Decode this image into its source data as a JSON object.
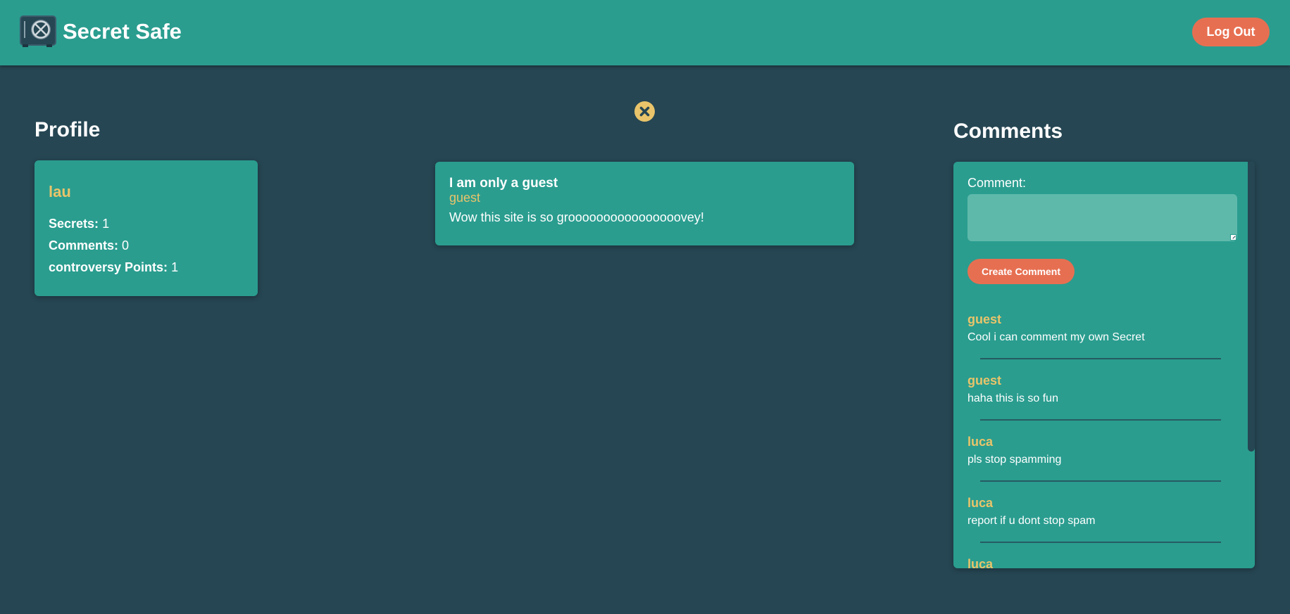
{
  "header": {
    "app_title": "Secret Safe",
    "logout_label": "Log Out",
    "logo_icon": "safe-icon"
  },
  "colors": {
    "background": "#264653",
    "primary": "#2a9d8f",
    "accent": "#e9c46a",
    "button": "#e76f51"
  },
  "profile": {
    "section_title": "Profile",
    "username": "lau",
    "stats": {
      "secrets_label": "Secrets:",
      "secrets_value": "1",
      "comments_label": "Comments:",
      "comments_value": "0",
      "points_label": "controversy Points:",
      "points_value": "1"
    }
  },
  "secret": {
    "close_icon": "close-icon",
    "title": "I am only a guest",
    "author": "guest",
    "body": "Wow this site is so groooooooooooooooovey!"
  },
  "comments": {
    "section_title": "Comments",
    "input_label": "Comment:",
    "input_value": "",
    "input_placeholder": "",
    "create_label": "Create Comment",
    "items": [
      {
        "author": "guest",
        "text": "Cool i can comment my own Secret"
      },
      {
        "author": "guest",
        "text": "haha this is so fun"
      },
      {
        "author": "luca",
        "text": "pls stop spamming"
      },
      {
        "author": "luca",
        "text": "report if u dont stop spam"
      },
      {
        "author": "luca",
        "text": ""
      }
    ]
  }
}
